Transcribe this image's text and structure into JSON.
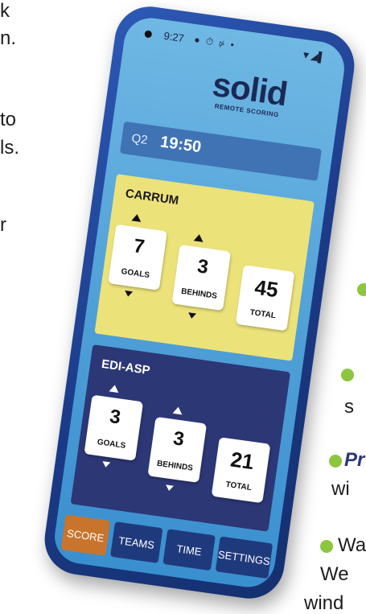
{
  "background": {
    "fragments": [
      "k",
      "n.",
      "to",
      "ls.",
      "r"
    ],
    "bullets": [
      "",
      "s",
      "Pr",
      "wi",
      "Wa",
      "We",
      "wind"
    ]
  },
  "status_bar": {
    "time": "9:27",
    "icons": "● ⏱ ⋫ •",
    "right": "▼◢▌"
  },
  "brand": {
    "name": "solid",
    "tagline": "REMOTE SCORING"
  },
  "clock": {
    "quarter": "Q2",
    "time": "19:50"
  },
  "home_team": {
    "name": "CARRUM",
    "goals": "7",
    "behinds": "3",
    "total": "45",
    "goals_label": "GOALS",
    "behinds_label": "BEHINDS",
    "total_label": "TOTAL",
    "color": "#ece27a"
  },
  "away_team": {
    "name": "EDI-ASP",
    "goals": "3",
    "behinds": "3",
    "total": "21",
    "goals_label": "GOALS",
    "behinds_label": "BEHINDS",
    "total_label": "TOTAL",
    "color": "#2c3776"
  },
  "nav": {
    "score": "SCORE",
    "teams": "TEAMS",
    "time": "TIME",
    "settings": "SETTINGS",
    "active": "SCORE",
    "accent": "#c9742c"
  }
}
